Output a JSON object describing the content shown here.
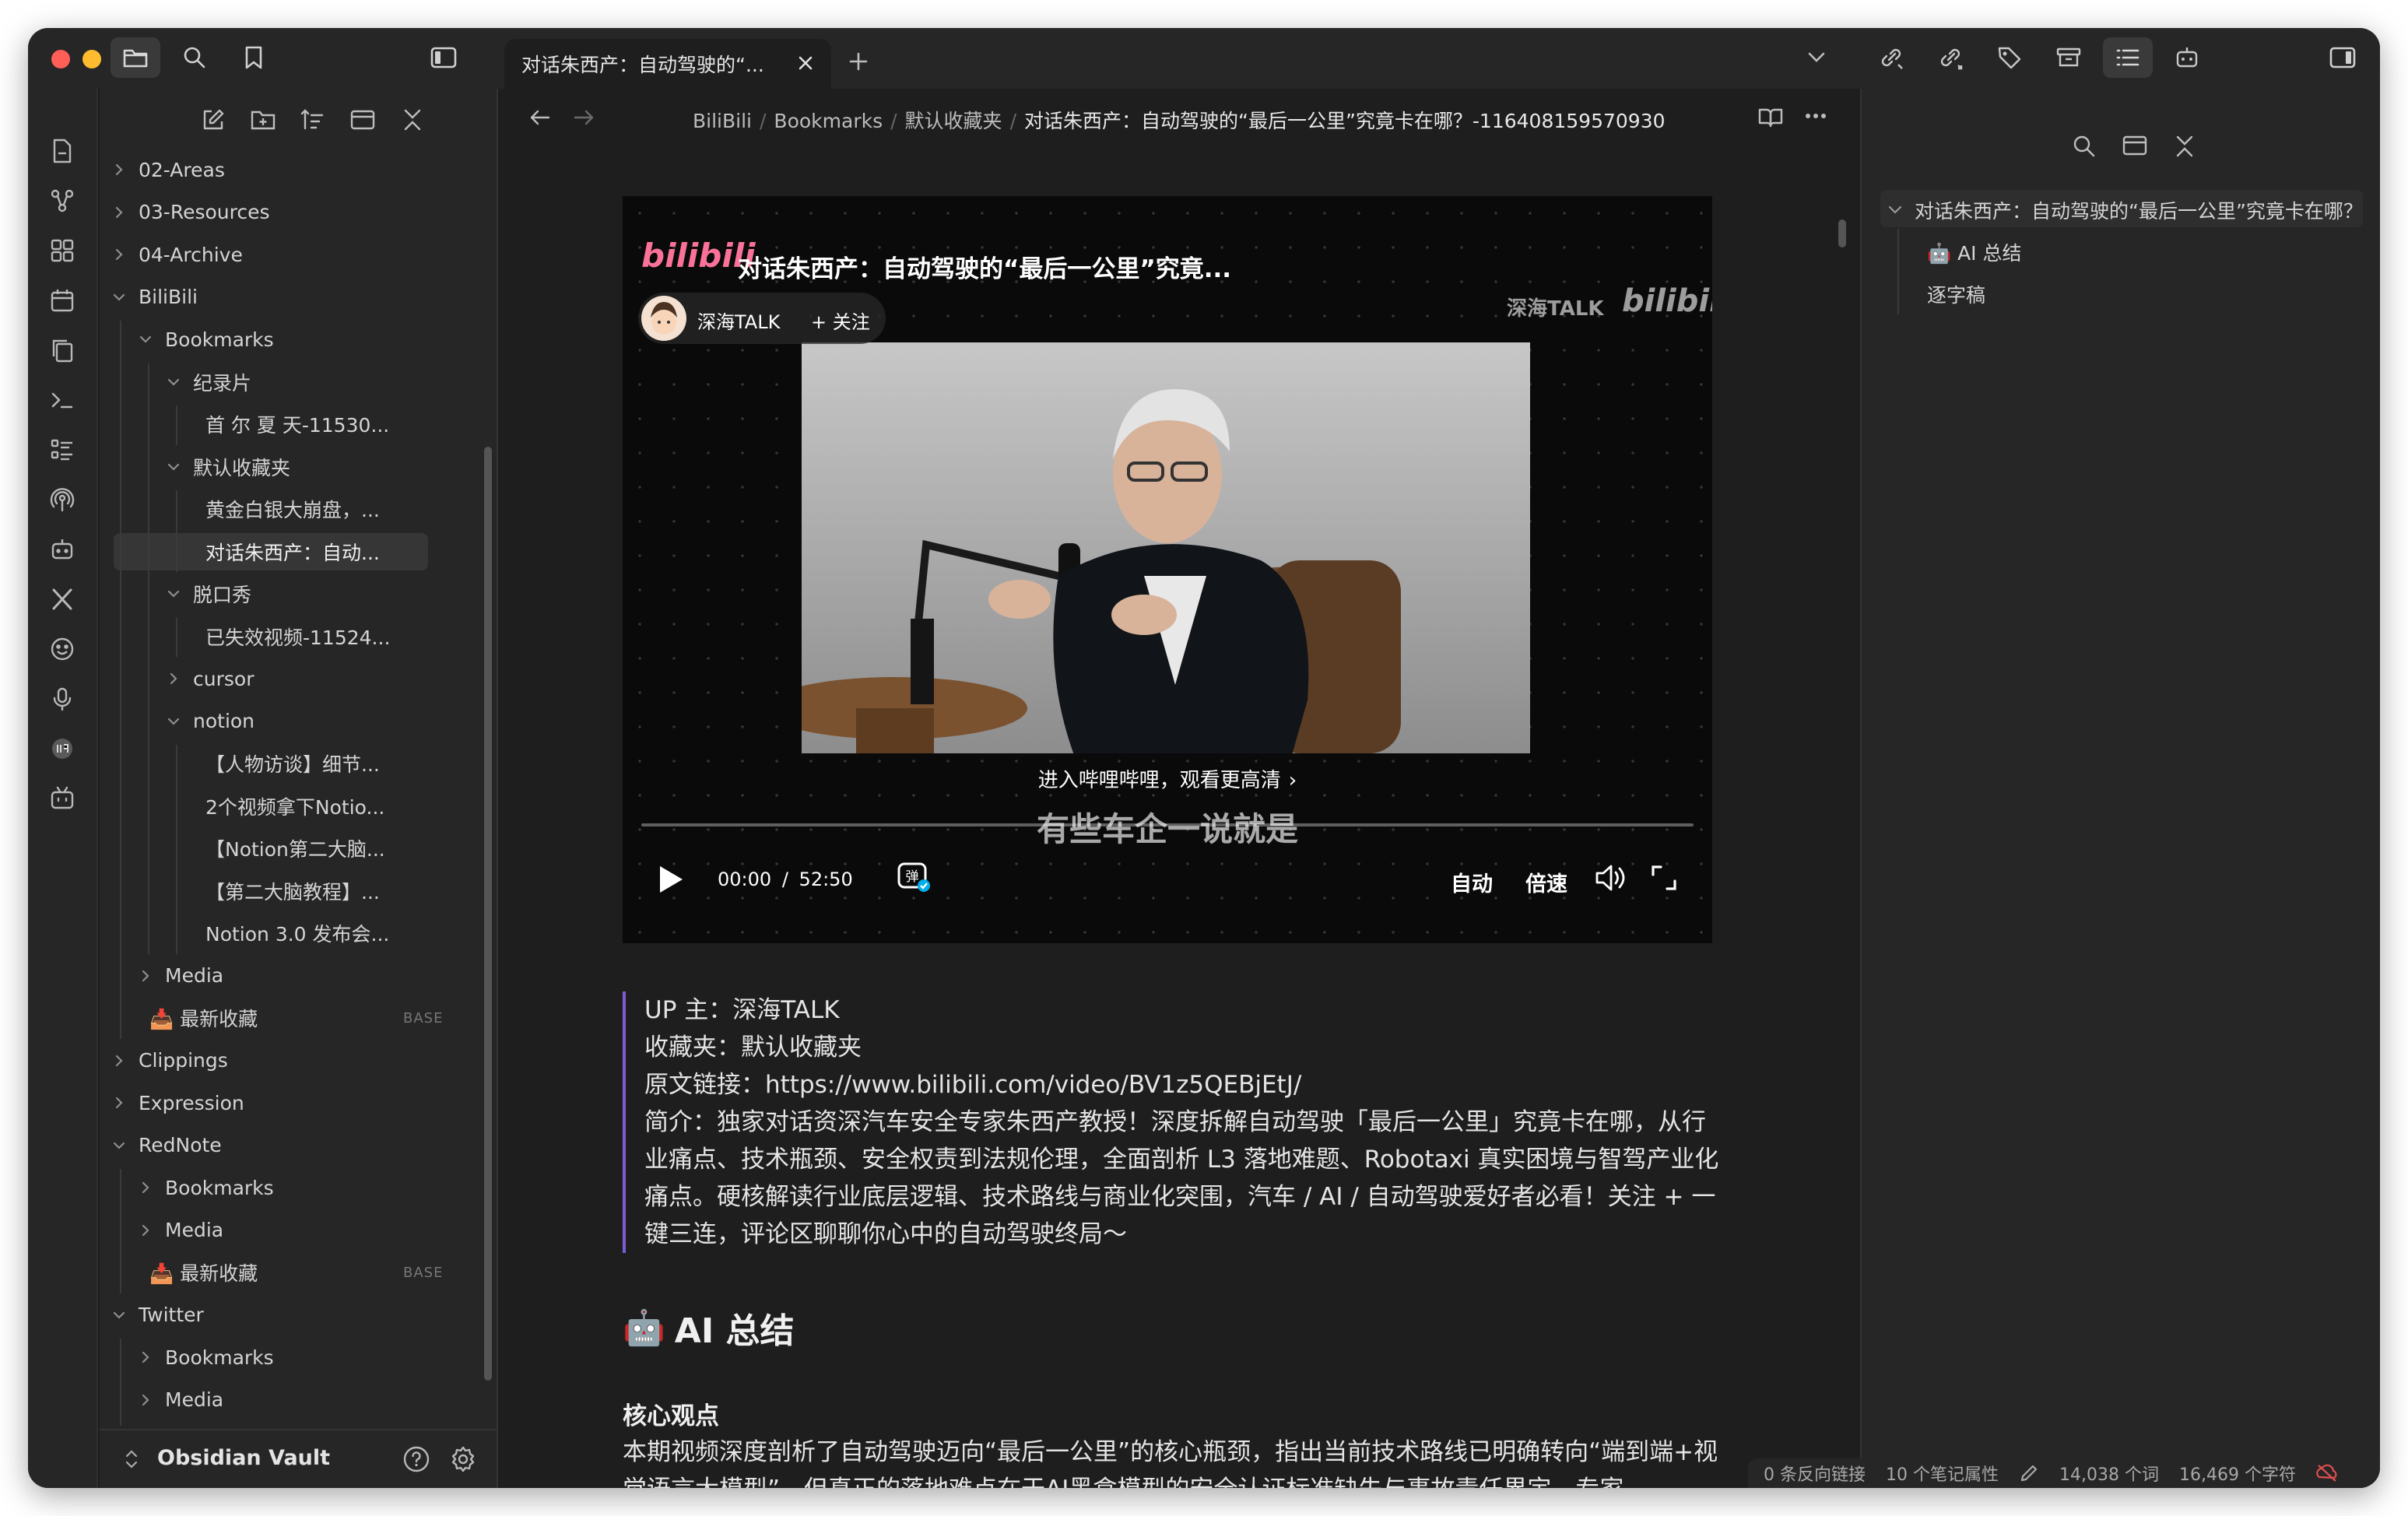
{
  "tab": {
    "title": "对话朱西产：自动驾驶的“..."
  },
  "breadcrumb": {
    "items": [
      "BiliBili",
      "Bookmarks",
      "默认收藏夹"
    ],
    "current": "对话朱西产：自动驾驶的“最后一公里”究竟卡在哪？-116408159570930"
  },
  "tree": {
    "items": [
      {
        "label": "02-Areas",
        "level": 0,
        "chevron": "right"
      },
      {
        "label": "03-Resources",
        "level": 0,
        "chevron": "right"
      },
      {
        "label": "04-Archive",
        "level": 0,
        "chevron": "right"
      },
      {
        "label": "BiliBili",
        "level": 0,
        "chevron": "down"
      },
      {
        "label": "Bookmarks",
        "level": 1,
        "chevron": "down"
      },
      {
        "label": "纪录片",
        "level": 2,
        "chevron": "down"
      },
      {
        "label": "首 尔 夏 天-11530...",
        "level": 3,
        "chevron": ""
      },
      {
        "label": "默认收藏夹",
        "level": 2,
        "chevron": "down"
      },
      {
        "label": "黄金白银大崩盘，...",
        "level": 3,
        "chevron": ""
      },
      {
        "label": "对话朱西产：自动...",
        "level": 3,
        "chevron": "",
        "selected": true
      },
      {
        "label": "脱口秀",
        "level": 2,
        "chevron": "down"
      },
      {
        "label": "已失效视频-11524...",
        "level": 3,
        "chevron": ""
      },
      {
        "label": "cursor",
        "level": 2,
        "chevron": "right"
      },
      {
        "label": "notion",
        "level": 2,
        "chevron": "down"
      },
      {
        "label": "【人物访谈】细节...",
        "level": 3,
        "chevron": ""
      },
      {
        "label": "2个视频拿下Notio...",
        "level": 3,
        "chevron": ""
      },
      {
        "label": "【Notion第二大脑...",
        "level": 3,
        "chevron": ""
      },
      {
        "label": "【第二大脑教程】...",
        "level": 3,
        "chevron": ""
      },
      {
        "label": "Notion 3.0 发布会...",
        "level": 3,
        "chevron": ""
      },
      {
        "label": "Media",
        "level": 1,
        "chevron": "right"
      },
      {
        "label": "📥 最新收藏",
        "level": 1,
        "chevron": "",
        "tag": "BASE"
      },
      {
        "label": "Clippings",
        "level": 0,
        "chevron": "right"
      },
      {
        "label": "Expression",
        "level": 0,
        "chevron": "right"
      },
      {
        "label": "RedNote",
        "level": 0,
        "chevron": "down"
      },
      {
        "label": "Bookmarks",
        "level": 1,
        "chevron": "right"
      },
      {
        "label": "Media",
        "level": 1,
        "chevron": "right"
      },
      {
        "label": "📥 最新收藏",
        "level": 1,
        "chevron": "",
        "tag": "BASE"
      },
      {
        "label": "Twitter",
        "level": 0,
        "chevron": "down"
      },
      {
        "label": "Bookmarks",
        "level": 1,
        "chevron": "right"
      },
      {
        "label": "Media",
        "level": 1,
        "chevron": "right"
      },
      {
        "label": "📥 最新收藏",
        "level": 1,
        "chevron": "",
        "tag": "BASE"
      }
    ]
  },
  "vault": {
    "name": "Obsidian Vault"
  },
  "video": {
    "logo": "bilibili",
    "title": "对话朱西产：自动驾驶的“最后一公里”究竟...",
    "uploader": "深海TALK",
    "follow": "+ 关注",
    "watermark": "深海TALK",
    "cta": "进入哔哩哔哩，观看更高清",
    "subtitle": "有些车企一说就是",
    "time_current": "00:00",
    "time_sep": "/",
    "time_total": "52:50",
    "danmaku": "弹",
    "quality": "自动",
    "speed": "倍速"
  },
  "article": {
    "quote_lines": [
      "UP 主：深海TALK",
      "收藏夹：默认收藏夹",
      "原文链接：https://www.bilibili.com/video/BV1z5QEBjEtJ/",
      "简介：独家对话资深汽车安全专家朱西产教授！深度拆解自动驾驶「最后一公里」究竟卡在哪，从行业痛点、技术瓶颈、安全权责到法规伦理，全面剖析 L3 落地难题、Robotaxi 真实困境与智驾产业化痛点。硬核解读行业底层逻辑、技术路线与商业化突围，汽车 / AI / 自动驾驶爱好者必看！关注 + 一键三连，评论区聊聊你心中的自动驾驶终局～"
    ],
    "h2": "AI 总结",
    "h2_emoji": "🤖",
    "h3": "核心观点",
    "para": "本期视频深度剖析了自动驾驶迈向“最后一公里”的核心瓶颈，指出当前技术路线已明确转向“端到端+视觉语言大模型”，但真正的落地难点在于AI黑盒模型的安全认证标准缺失与事故责任界定。专家"
  },
  "outline": {
    "title": "对话朱西产：自动驾驶的“最后一公里”究竟卡在哪？",
    "items": [
      "🤖 AI 总结",
      "逐字稿"
    ]
  },
  "status": {
    "backlinks": "0 条反向链接",
    "properties": "10 个笔记属性",
    "words": "14,038 个词",
    "chars": "16,469 个字符"
  },
  "colors": {
    "accent": "#7b5cd6",
    "bilibili_pink": "#fb7299",
    "bg": "#1e1e1e",
    "panel": "#262626"
  }
}
